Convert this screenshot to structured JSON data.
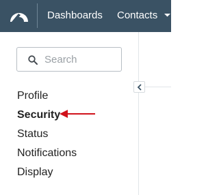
{
  "header": {
    "logo_icon": "app-logo-icon",
    "nav": [
      {
        "label": "Dashboards"
      },
      {
        "label": "Contacts",
        "caret_icon": "caret-down-icon"
      }
    ],
    "colors": {
      "background": "#3a5264",
      "text": "#ffffff"
    }
  },
  "sidebar": {
    "search": {
      "placeholder": "Search",
      "value": "",
      "icon": "search-icon"
    },
    "items": [
      {
        "label": "Profile",
        "active": false
      },
      {
        "label": "Security",
        "active": true
      },
      {
        "label": "Status",
        "active": false
      },
      {
        "label": "Notifications",
        "active": false
      },
      {
        "label": "Display",
        "active": false
      }
    ],
    "collapse_icon": "chevron-left-icon"
  },
  "annotation": {
    "type": "arrow",
    "points_to": "Security",
    "color": "#d0111b"
  }
}
